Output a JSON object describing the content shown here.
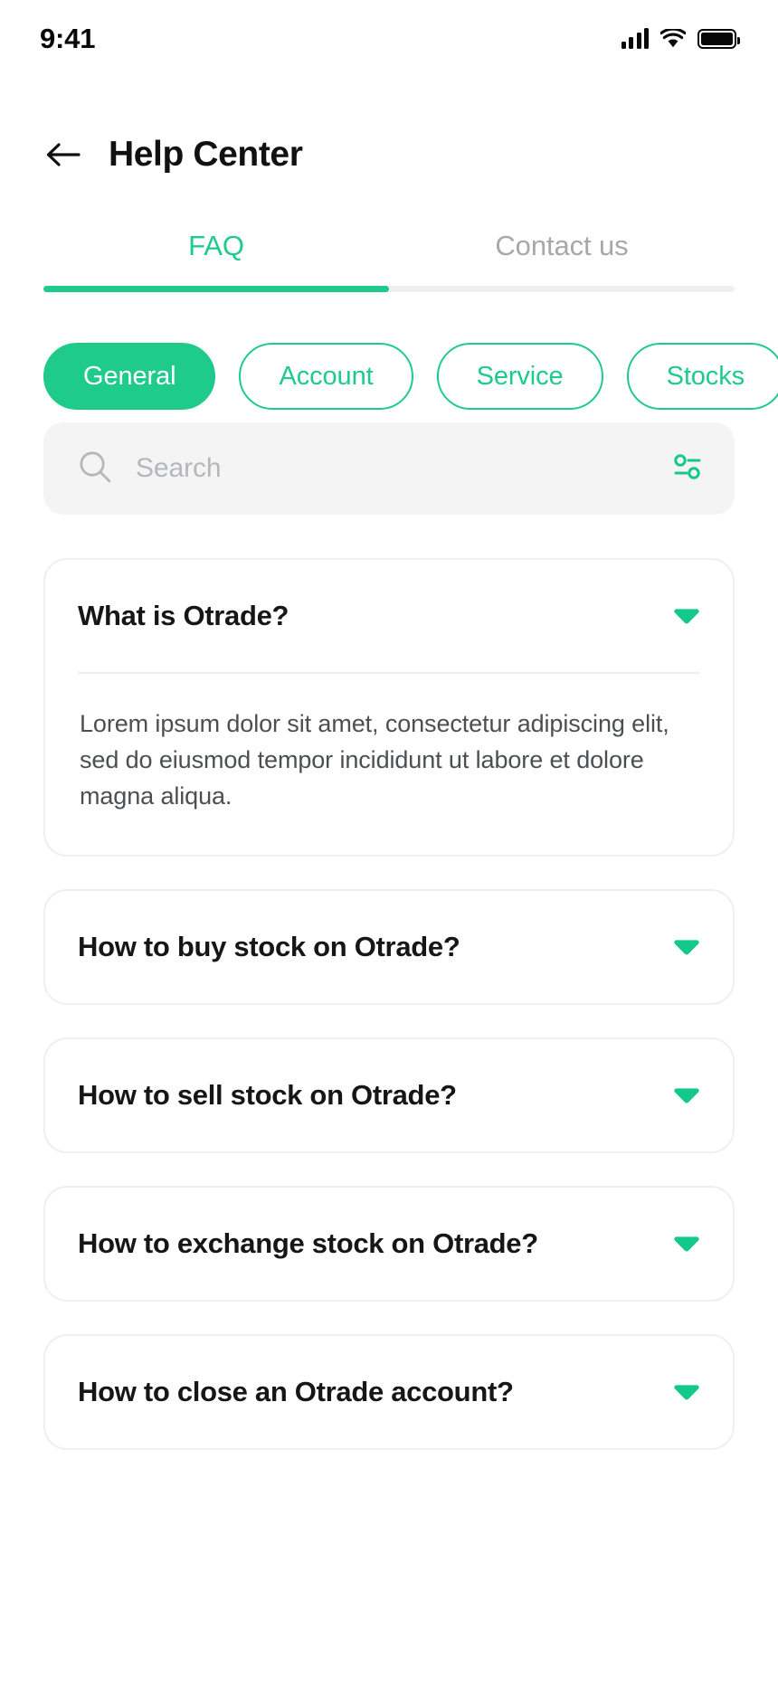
{
  "status_bar": {
    "time": "9:41",
    "signal_icon": "cellular-signal-icon",
    "wifi_icon": "wifi-icon",
    "battery_icon": "battery-full-icon"
  },
  "header": {
    "back_icon": "back-arrow-icon",
    "title": "Help Center"
  },
  "tabs": {
    "items": [
      {
        "label": "FAQ",
        "active": true
      },
      {
        "label": "Contact us",
        "active": false
      }
    ]
  },
  "categories": {
    "items": [
      {
        "label": "General",
        "active": true
      },
      {
        "label": "Account",
        "active": false
      },
      {
        "label": "Service",
        "active": false
      },
      {
        "label": "Stocks",
        "active": false
      }
    ]
  },
  "search": {
    "placeholder": "Search",
    "value": "",
    "search_icon": "search-icon",
    "filter_icon": "filter-sliders-icon"
  },
  "faq": {
    "items": [
      {
        "question": "What is Otrade?",
        "answer": "Lorem ipsum dolor sit amet, consectetur adipiscing elit, sed do eiusmod tempor incididunt ut labore et dolore magna aliqua.",
        "expanded": true
      },
      {
        "question": "How to buy stock on Otrade?",
        "answer": "",
        "expanded": false
      },
      {
        "question": "How to sell stock on Otrade?",
        "answer": "",
        "expanded": false
      },
      {
        "question": "How to exchange stock on Otrade?",
        "answer": "",
        "expanded": false
      },
      {
        "question": "How to close an Otrade account?",
        "answer": "",
        "expanded": false
      }
    ],
    "chevron_icon": "chevron-down-icon"
  },
  "colors": {
    "accent": "#1ECB8B",
    "text_primary": "#161616",
    "text_muted": "#A5A8AC",
    "search_bg": "#F4F4F4",
    "card_border": "#EFEFEF"
  }
}
